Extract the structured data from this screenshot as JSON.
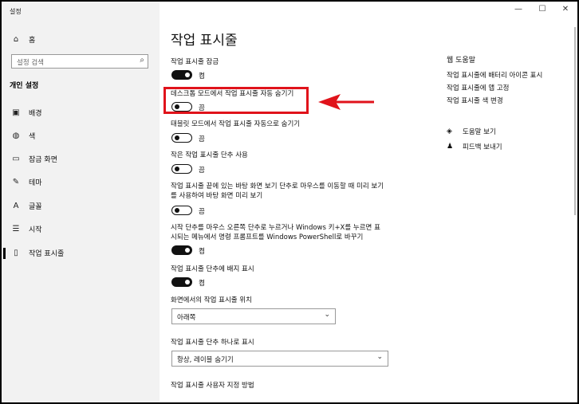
{
  "window": {
    "title": "설정",
    "minimize": "—",
    "maximize": "☐",
    "close": "✕"
  },
  "sidebar": {
    "home": "홈",
    "search_placeholder": "설정 검색",
    "section": "개인 설정",
    "items": [
      {
        "label": "배경",
        "icon": "picture-icon",
        "glyph": "▣"
      },
      {
        "label": "색",
        "icon": "palette-icon",
        "glyph": "◍"
      },
      {
        "label": "잠금 화면",
        "icon": "lock-screen-icon",
        "glyph": "▭"
      },
      {
        "label": "테마",
        "icon": "brush-icon",
        "glyph": "✎"
      },
      {
        "label": "글꼴",
        "icon": "font-icon",
        "glyph": "A"
      },
      {
        "label": "시작",
        "icon": "start-icon",
        "glyph": "☰"
      },
      {
        "label": "작업 표시줄",
        "icon": "taskbar-icon",
        "glyph": "▯"
      }
    ]
  },
  "main": {
    "title": "작업 표시줄",
    "settings": [
      {
        "label": "작업 표시줄 잠금",
        "state": "켬",
        "on": true
      },
      {
        "label": "데스크톱 모드에서 작업 표시줄 자동 숨기기",
        "state": "끔",
        "on": false
      },
      {
        "label": "태블릿 모드에서 작업 표시줄 자동으로 숨기기",
        "state": "끔",
        "on": false
      },
      {
        "label": "작은 작업 표시줄 단추 사용",
        "state": "끔",
        "on": false
      },
      {
        "label": "작업 표시줄 끝에 있는 바탕 화면 보기 단추로 마우스를 이동할 때 미리 보기를 사용하여 바탕 화면 미리 보기",
        "state": "끔",
        "on": false
      },
      {
        "label": "시작 단추를 마우스 오른쪽 단추로 누르거나 Windows 키+X를 누르면 표시되는 메뉴에서 명령 프롬프트를 Windows PowerShell로 바꾸기",
        "state": "켬",
        "on": true
      },
      {
        "label": "작업 표시줄 단추에 배지 표시",
        "state": "켬",
        "on": true
      }
    ],
    "position_label": "화면에서의 작업 표시줄 위치",
    "position_value": "아래쪽",
    "combine_label": "작업 표시줄 단추 하나로 표시",
    "combine_value": "항상, 레이블 숨기기",
    "customize_link": "작업 표시줄 사용자 지정 방법"
  },
  "right": {
    "help_title": "웹 도움말",
    "links": [
      "작업 표시줄에 배터리 아이콘 표시",
      "작업 표시줄에 앱 고정",
      "작업 표시줄 색 변경"
    ],
    "get_help": "도움말 보기",
    "feedback": "피드백 보내기"
  },
  "colors": {
    "highlight": "#e0131b",
    "toggle_on": "#111111"
  }
}
